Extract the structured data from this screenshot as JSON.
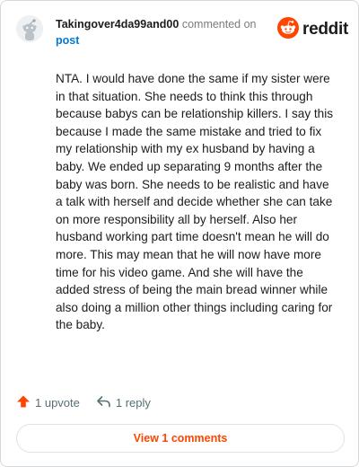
{
  "header": {
    "username": "Takingover4da99and00",
    "commented_text": "commented on",
    "post_link": "post",
    "brand_name": "reddit"
  },
  "comment": {
    "text": "NTA. I would have done the same if my sister were in that situation. She needs to think this through because babys can be relationship killers. I say this because I made the same mistake and tried to fix my relationship with my ex husband by having a baby. We ended up separating 9 months after the baby was born. She needs to be realistic and have a talk with herself and decide whether she can take on more responsibility all by herself. Also her husband working part time doesn't mean he will do more. This may mean that he will now have more time for his video game. And she will have the added stress of being the main bread winner while also doing a million other things including caring for the baby."
  },
  "actions": {
    "upvote_label": "1 upvote",
    "reply_label": "1 reply"
  },
  "footer": {
    "view_comments_label": "View 1 comments"
  },
  "icons": {
    "avatar": "snoo-avatar-icon",
    "brand": "reddit-logo-icon",
    "upvote": "upvote-arrow-icon",
    "reply": "reply-arrow-icon"
  },
  "colors": {
    "brand_orange": "#ff4500",
    "link_blue": "#0079d3",
    "meta_gray": "#7c7c7c",
    "action_gray": "#576f76"
  }
}
